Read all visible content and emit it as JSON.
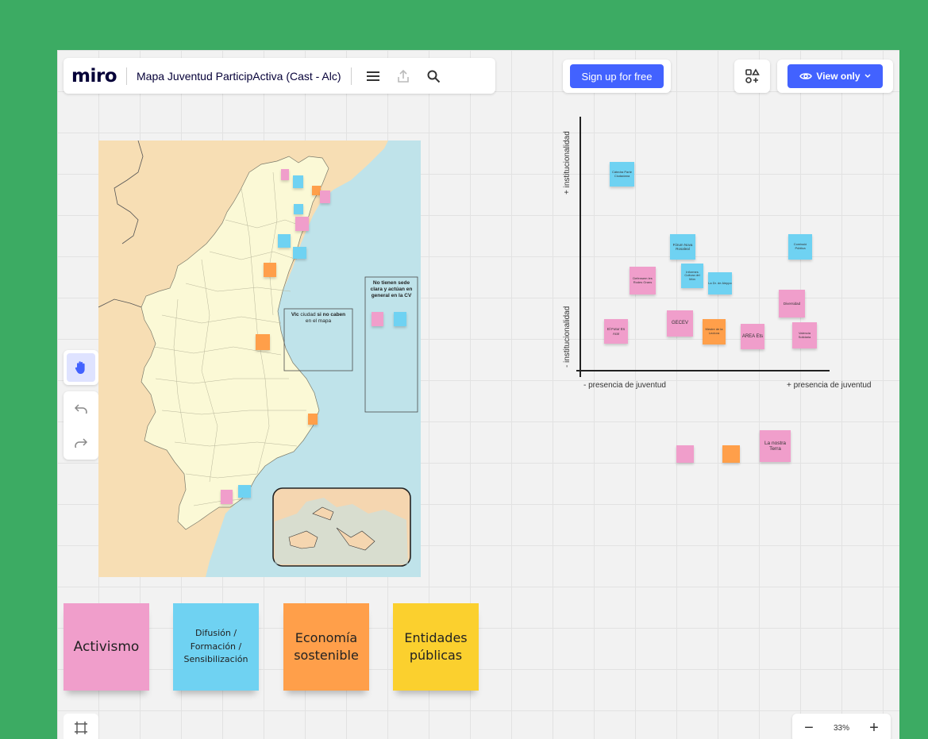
{
  "colors": {
    "frame": "#3cab63",
    "accent": "#4262ff",
    "pink": "#f09ecb",
    "blue": "#6fd2f2",
    "orange": "#ff9f4a",
    "yellow": "#fbd02e",
    "land": "#fbf9d6",
    "spain_land": "#f7deb4",
    "sea": "#bfe3ea"
  },
  "toolbar": {
    "logo": "miro",
    "board_title": "Mapa Juventud ParticipActiva (Cast - Alc)",
    "icons": [
      "menu-icon",
      "share-icon",
      "search-icon"
    ]
  },
  "signup_label": "Sign up for free",
  "view_only_label": "View only",
  "zoom": {
    "value": "33%",
    "minus": "−",
    "plus": "+"
  },
  "map": {
    "no_sede_text": "No tienen sede clara y actúan en general en la CV",
    "vlc_text_1": "Vlc",
    "vlc_text_2": "ciudad",
    "vlc_text_3": "si no",
    "vlc_text_4": "caben",
    "vlc_text_5": "en el mapa"
  },
  "quadrant": {
    "y_plus": "+ institucionalidad",
    "y_minus": "- institucionalidad",
    "x_minus": "- presencia de juventud",
    "x_plus": "+ presencia de juventud",
    "notes": [
      {
        "text": "Cátedra Parte Ciudadana",
        "color": "blue"
      },
      {
        "text": "Fórum Nova Rosaleal",
        "color": "blue"
      },
      {
        "text": "Comissió Pública",
        "color": "blue"
      },
      {
        "text": "Defensem les Rodes Grans",
        "color": "pink"
      },
      {
        "text": "Informes Cultura del Món",
        "color": "blue"
      },
      {
        "text": "La Dr. de Aleppo",
        "color": "blue"
      },
      {
        "text": "Diversidad",
        "color": "pink"
      },
      {
        "text": "El Futur Es Ara!",
        "color": "pink"
      },
      {
        "text": "GECEV",
        "color": "pink"
      },
      {
        "text": "Mestre de la Lectora",
        "color": "orange"
      },
      {
        "text": "AREA Ets",
        "color": "pink"
      },
      {
        "text": "Valencia Solidaria",
        "color": "pink"
      },
      {
        "text": "",
        "color": "pink"
      },
      {
        "text": "",
        "color": "orange"
      },
      {
        "text": "La nostra Terra",
        "color": "pink"
      }
    ]
  },
  "legend": [
    {
      "label": "Activismo",
      "color": "pink"
    },
    {
      "label": "Difusión / Formación / Sensibilización",
      "color": "blue"
    },
    {
      "label": "Economía sostenible",
      "color": "orange"
    },
    {
      "label": "Entidades públicas",
      "color": "yellow"
    }
  ]
}
